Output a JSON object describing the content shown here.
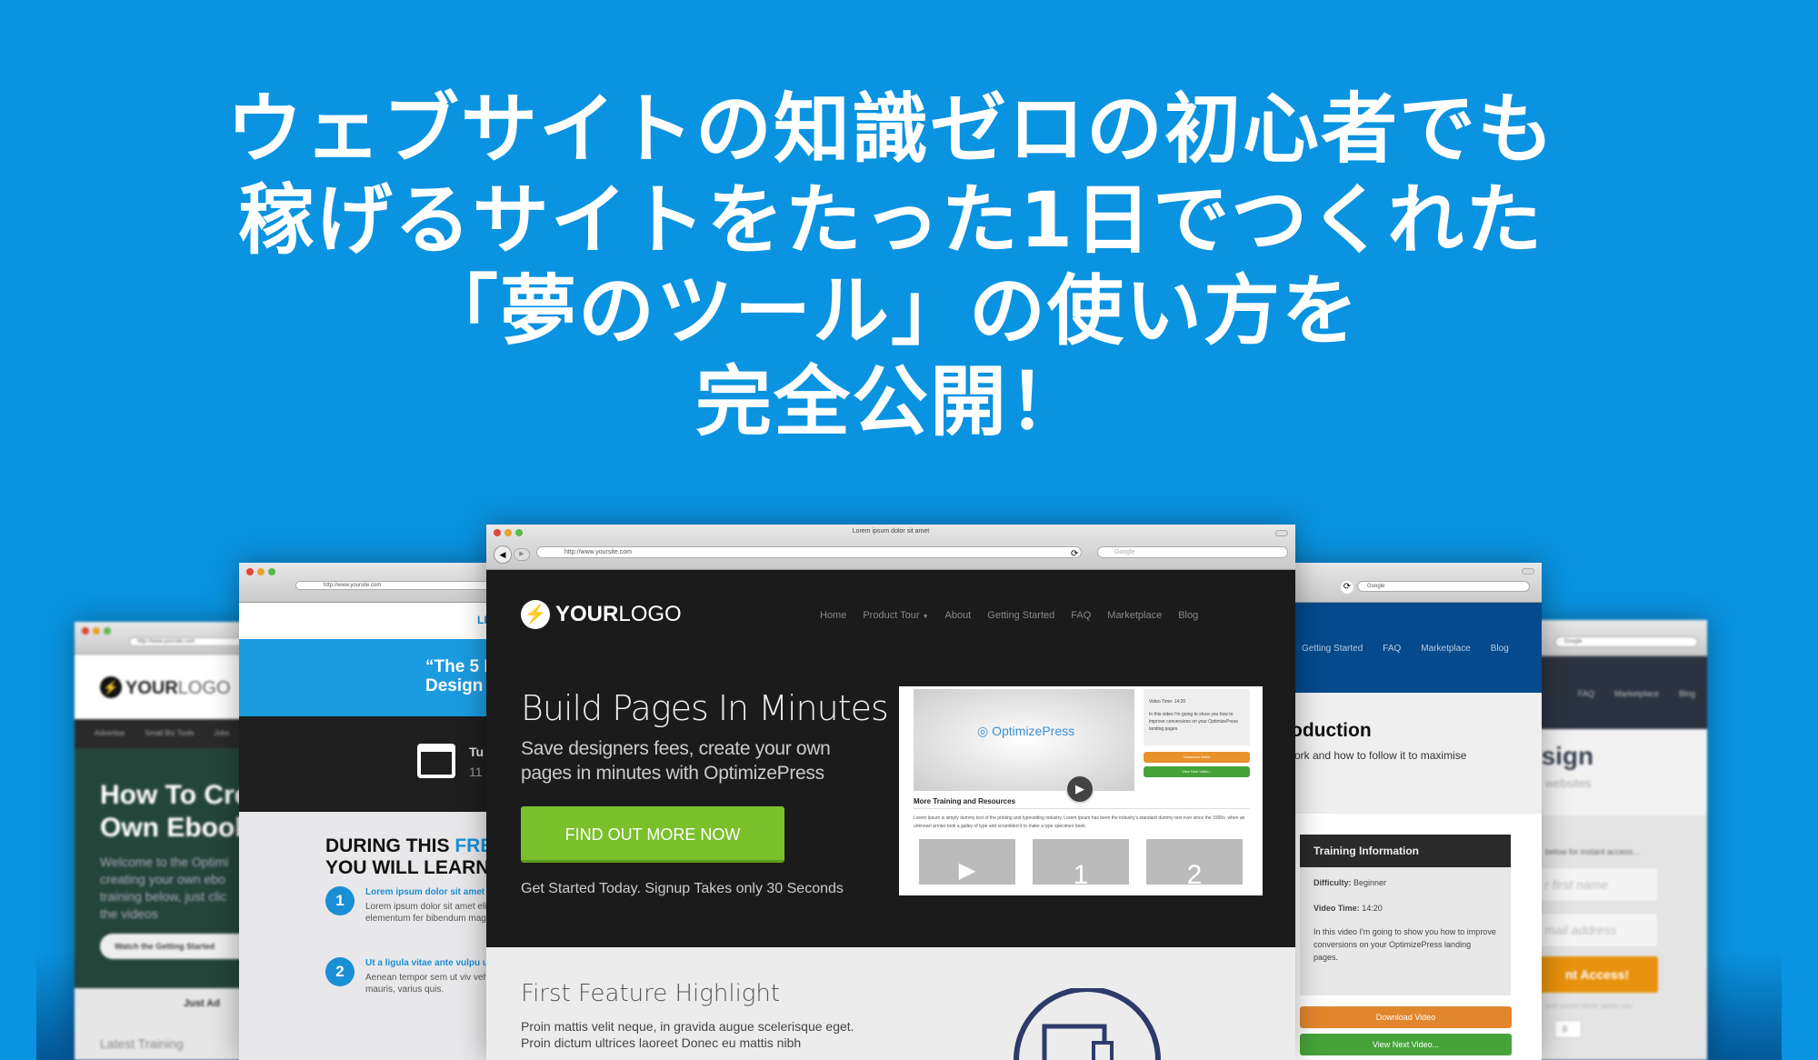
{
  "headline": {
    "lines": [
      "ウェブサイトの知識ゼロの初心者でも",
      "稼げるサイトをたった1日でつくれた",
      "「夢のツール」の使い方を",
      "完全公開！"
    ]
  },
  "colors": {
    "background": "#0a93e0",
    "cta_green": "#7ac02a",
    "orange": "#e8922b",
    "green": "#46a33a"
  },
  "center": {
    "window_title": "Lorem ipsum dolor sit amet",
    "url": "http://www.yoursite.com",
    "search_placeholder": "Google",
    "logo_bold": "YOUR",
    "logo_light": "LOGO",
    "nav": [
      "Home",
      "Product Tour",
      "About",
      "Getting Started",
      "FAQ",
      "Marketplace",
      "Blog"
    ],
    "hero_title": "Build Pages In Minutes",
    "hero_sub_1": "Save designers fees, create your own",
    "hero_sub_2": "pages in minutes with OptimizePress",
    "cta": "FIND OUT MORE NOW",
    "cta_note": "Get Started Today. Signup Takes only 30 Seconds",
    "video": {
      "brand": "OptimizePress",
      "more": "More Training and Resources",
      "lorem": "Lorem Ipsum is simply dummy text of the printing and typesetting industry. Lorem Ipsum has been the industry's standard dummy text ever since the 1500s, when an unknown printer took a galley of type and scrambled it to make a type specimen book.",
      "side_1": "Video Time: 14:20",
      "side_2": "In this video I'm going to show you how to improve conversions on your OptimizePress landing pages.",
      "btn_download": "Download Video",
      "btn_next": "View Next Video...",
      "thumbs": [
        "1",
        "2"
      ]
    },
    "feature_title": "First Feature Highlight",
    "feature_p1": "Proin mattis velit neque, in gravida augue scelerisque eget.",
    "feature_p2": "Proin dictum ultrices laoreet Donec eu mattis nibh"
  },
  "left1": {
    "url": "http://www.yoursite.com",
    "logo_bold": "YOUR",
    "logo_light": "LOGO",
    "nav": [
      "Advertise",
      "Small Biz Tools",
      "Jobs"
    ],
    "title_1": "How To Cre",
    "title_2": "Own Ebook",
    "body": "Welcome to the Optimi creating your own ebo training below, just clic the videos",
    "button": "Watch the Getting Started",
    "just": "Just Ad",
    "latest": "Latest Training"
  },
  "left2": {
    "url": "http://www.yoursite.com",
    "top": "LIV",
    "quote_1": "“The 5 F",
    "quote_2": "Design",
    "date_1": "Tu",
    "date_2": "11",
    "learn_1a": "DURING THIS ",
    "learn_1b": "FRE",
    "learn_2": "YOU WILL LEARN:",
    "items": [
      {
        "num": "1",
        "title": "Lorem ipsum dolor sit amet elit.",
        "body": "Lorem ipsum dolor sit amet elit. Mauris elementum fer bibendum magna ultrices s"
      },
      {
        "num": "2",
        "title": "Ut a ligula vitae ante vulpu urna.",
        "body": "Aenean tempor sem ut viv vehicula bibendum mauris, varius quis."
      }
    ]
  },
  "right1": {
    "search_placeholder": "Google",
    "nav": [
      "Getting Started",
      "FAQ",
      "Marketplace",
      "Blog"
    ],
    "title": "oduction",
    "sub": "ork and how to follow it to maximise",
    "box_title": "Training Information",
    "difficulty_label": "Difficulty:",
    "difficulty": "Beginner",
    "time_label": "Video Time:",
    "time": "14:20",
    "desc": "In this video I'm going to show you how to improve conversions on your OptimizePress landing pages.",
    "btn_download": "Download Video",
    "btn_next": "View Next Video..."
  },
  "right2": {
    "search_placeholder": "Google",
    "nav": [
      "FAQ",
      "Marketplace",
      "Blog"
    ],
    "title": "esign",
    "sub": "websites",
    "prompt": "below for instant access...",
    "name_ph": "r first name",
    "email_ph": "mail address",
    "button": "nt Access!",
    "note": "and would never spam you",
    "captcha": "0"
  }
}
